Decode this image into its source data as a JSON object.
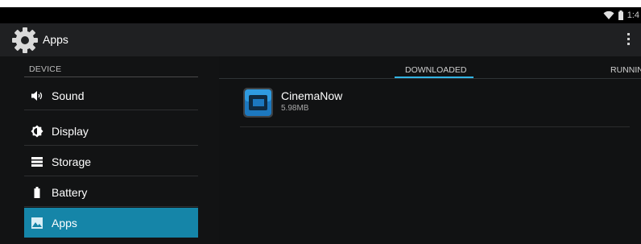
{
  "status_bar": {
    "clock": "1:4",
    "icons": [
      "wifi-icon",
      "battery-icon"
    ]
  },
  "action_bar": {
    "title": "Apps",
    "app_icon": "settings-gear-icon",
    "overflow_icon": "overflow-menu-icon"
  },
  "sidebar": {
    "section_header": "DEVICE",
    "items": [
      {
        "label": "Sound",
        "icon": "volume-icon",
        "selected": false
      },
      {
        "label": "Display",
        "icon": "brightness-icon",
        "selected": false
      },
      {
        "label": "Storage",
        "icon": "storage-icon",
        "selected": false
      },
      {
        "label": "Battery",
        "icon": "battery-icon",
        "selected": false
      },
      {
        "label": "Apps",
        "icon": "apps-picture-icon",
        "selected": true
      }
    ]
  },
  "tabs": [
    {
      "label": "DOWNLOADED",
      "selected": true
    },
    {
      "label": "RUNNIN",
      "selected": false
    }
  ],
  "apps": [
    {
      "name": "CinemaNow",
      "size": "5.98MB",
      "icon": "cinemanow-app-icon"
    }
  ],
  "colors": {
    "accent": "#33b5e5",
    "selected_item": "#1585a8",
    "background": "#111213",
    "action_bar": "#1f2022"
  }
}
